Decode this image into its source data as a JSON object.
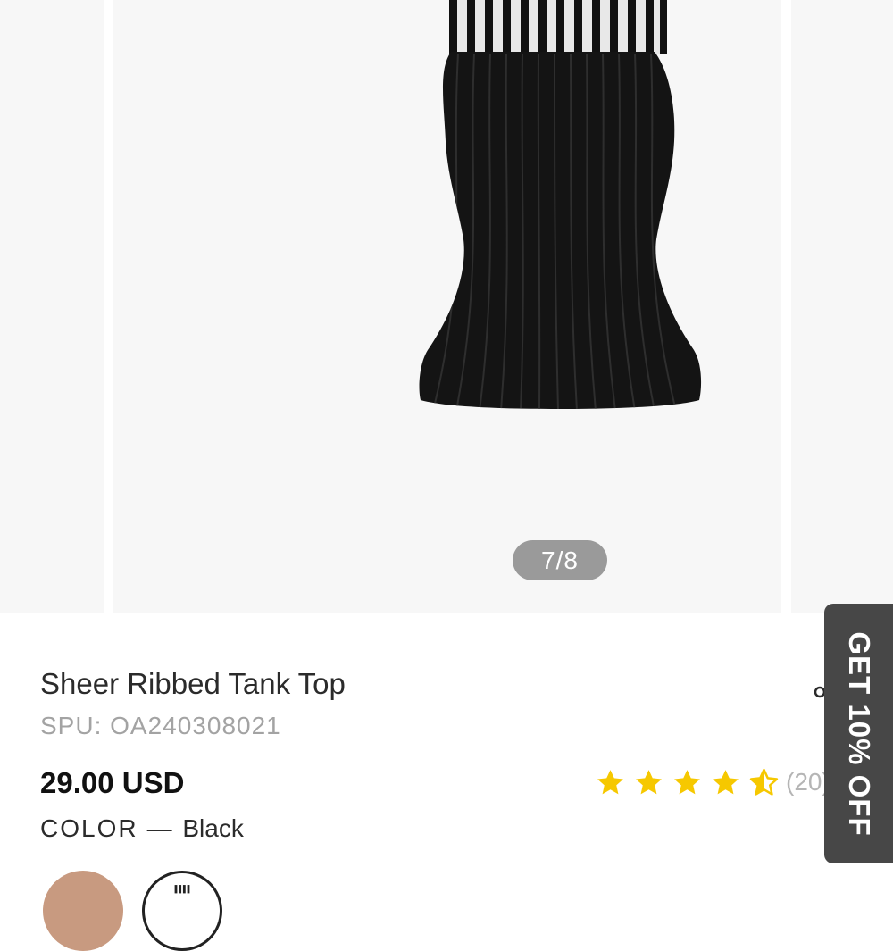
{
  "gallery": {
    "counter": "7/8",
    "image_alt": "Black sheer ribbed tank top"
  },
  "product": {
    "title": "Sheer Ribbed Tank Top",
    "spu": "SPU: OA240308021",
    "price": "29.00 USD",
    "color_label": "COLOR",
    "color_separator": "—",
    "color_value": "Black"
  },
  "rating": {
    "value": 4.5,
    "max": 5,
    "count": "(20)"
  },
  "promo": {
    "label": "GET 10% OFF"
  },
  "swatches": [
    {
      "name": "Brown",
      "selected": false
    },
    {
      "name": "Black",
      "selected": true
    }
  ],
  "colors": {
    "star": "#f6c800",
    "counter_bg": "#9a9a9a",
    "promo_bg": "#474747",
    "gallery_bg": "#f7f7f7"
  },
  "icons": [
    "share-icon",
    "star-icon",
    "half-star-icon"
  ]
}
